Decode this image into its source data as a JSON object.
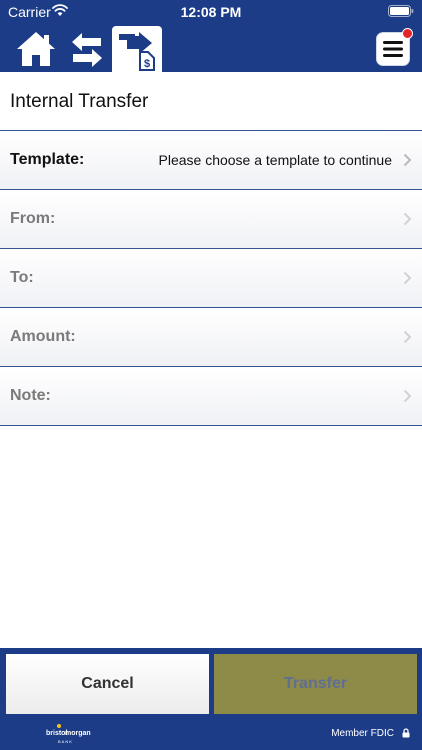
{
  "status_bar": {
    "carrier": "Carrier",
    "time": "12:08 PM"
  },
  "nav": {
    "icons": [
      "home-icon",
      "transfer-arrows-icon",
      "internal-transfer-icon",
      "hamburger-menu-icon"
    ],
    "menu_badge_color": "#e4232a"
  },
  "page": {
    "title": "Internal Transfer"
  },
  "form": {
    "template_label": "Template:",
    "template_value": "Please choose a template to continue",
    "from_label": "From:",
    "to_label": "To:",
    "amount_label": "Amount:",
    "note_label": "Note:"
  },
  "actions": {
    "cancel_label": "Cancel",
    "transfer_label": "Transfer"
  },
  "footer": {
    "logo_word_1": "bristol",
    "logo_word_2": "morgan",
    "logo_sub": "BANK",
    "fdic": "Member FDIC"
  },
  "colors": {
    "brand_navy": "#1d3c88",
    "divider": "#33548f",
    "transfer_disabled": "#8d8b47",
    "logo_accent": "#f4c21b"
  }
}
